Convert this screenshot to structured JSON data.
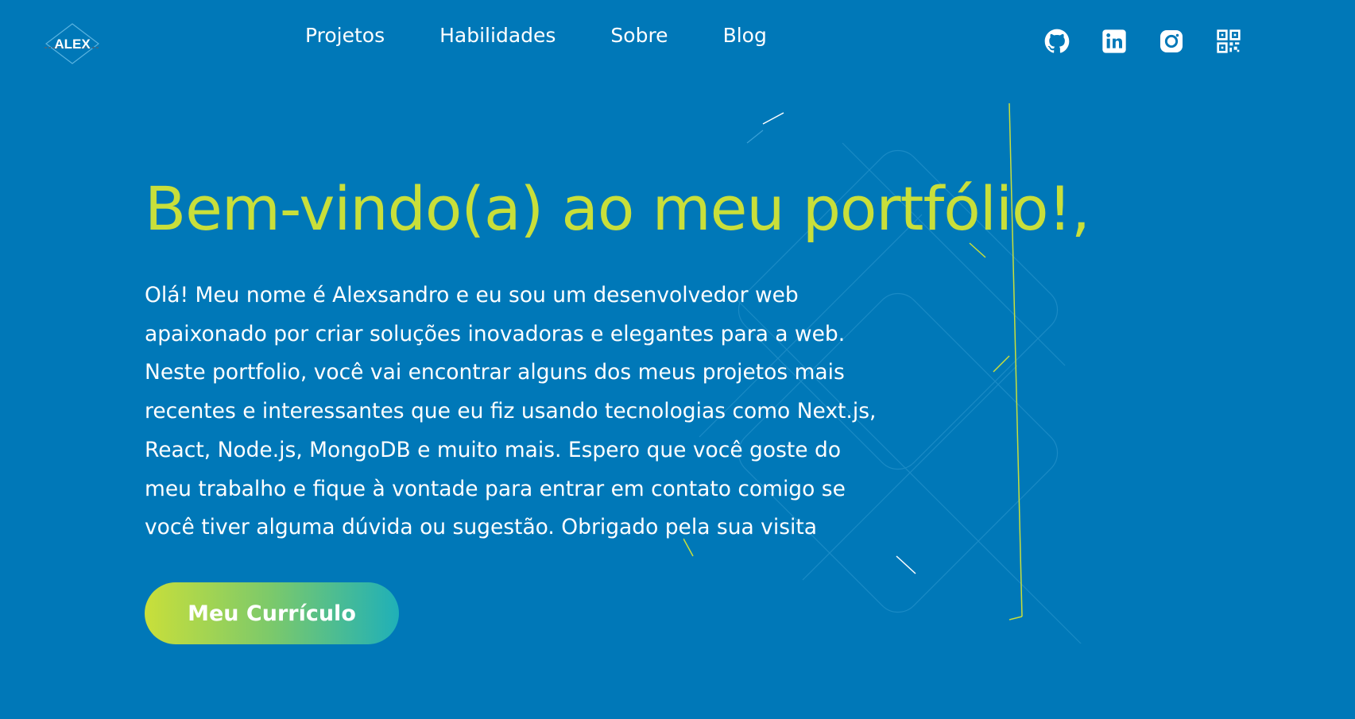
{
  "logo": {
    "text": "ALEX"
  },
  "nav": {
    "items": [
      {
        "label": "Projetos"
      },
      {
        "label": "Habilidades"
      },
      {
        "label": "Sobre"
      },
      {
        "label": "Blog"
      }
    ]
  },
  "social": {
    "icons": [
      "github-icon",
      "linkedin-icon",
      "instagram-icon",
      "qr-code-icon"
    ]
  },
  "hero": {
    "title": "Bem-vindo(a) ao meu portfólio!,",
    "lines": [
      "Olá! Meu nome é Alexsandro e eu sou um desenvolvedor web",
      "apaixonado por criar soluções inovadoras e elegantes para a web.",
      "Neste portfolio, você vai encontrar alguns dos meus projetos mais",
      "recentes e interessantes que eu fiz usando tecnologias como Next.js,",
      "React, Node.js, MongoDB e muito mais. Espero que você goste do",
      "meu trabalho e fique à vontade para entrar em contato comigo se",
      "você tiver alguma dúvida ou sugestão. Obrigado pela sua visita"
    ],
    "button_label": "Meu Currículo"
  },
  "colors": {
    "background": "#0078b8",
    "accent": "#c9df3a",
    "button_gradient_end": "#1fb0b8"
  }
}
